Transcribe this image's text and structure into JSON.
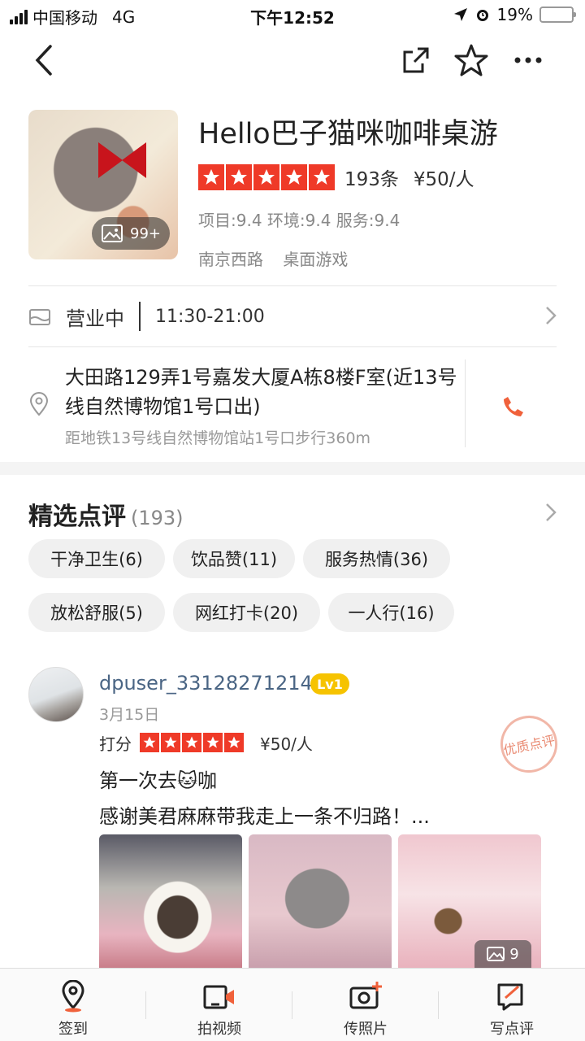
{
  "status_bar": {
    "carrier": "中国移动",
    "network": "4G",
    "time": "下午12:52",
    "battery": "19%",
    "battery_level": 0.19
  },
  "nav": {
    "back_icon": "chevron-left-icon",
    "share_icon": "share-icon",
    "favorite_icon": "star-outline-icon",
    "more_icon": "more-icon"
  },
  "shop": {
    "name": "Hello巴子猫咪咖啡桌游",
    "photo_count": "99+",
    "star_rating": 5,
    "review_count": "193条",
    "price": "¥50/人",
    "scores": "项目:9.4 环境:9.4 服务:9.4",
    "tags": [
      "南京西路",
      "桌面游戏"
    ]
  },
  "hours": {
    "status": "营业中",
    "time": "11:30-21:00"
  },
  "address": {
    "text": "大田路129弄1号嘉发大厦A栋8楼F室(近13号线自然博物馆1号口出)",
    "subway": "距地铁13号线自然博物馆站1号口步行360m"
  },
  "reviews": {
    "title": "精选点评",
    "count": "(193)",
    "chips": [
      "干净卫生(6)",
      "饮品赞(11)",
      "服务热情(36)",
      "放松舒服(5)",
      "网红打卡(20)",
      "一人行(16)"
    ],
    "items": [
      {
        "user": "dpuser_33128271214",
        "level": "Lv1",
        "date": "3月15日",
        "rating_label": "打分",
        "stars": 5,
        "price": "¥50/人",
        "stamp": "优质点评",
        "line1": "第一次去🐱咖",
        "line2": "感谢美君麻麻带我走上一条不归路！...",
        "image_count": "9"
      }
    ]
  },
  "colors": {
    "accent": "#ef3a28",
    "phone": "#f0613b",
    "username": "#4a6584",
    "level_badge": "#f6c300"
  },
  "bottom_bar": [
    {
      "label": "签到",
      "icon": "checkin-pin-icon"
    },
    {
      "label": "拍视频",
      "icon": "video-camera-icon"
    },
    {
      "label": "传照片",
      "icon": "camera-plus-icon"
    },
    {
      "label": "写点评",
      "icon": "write-review-icon"
    }
  ]
}
